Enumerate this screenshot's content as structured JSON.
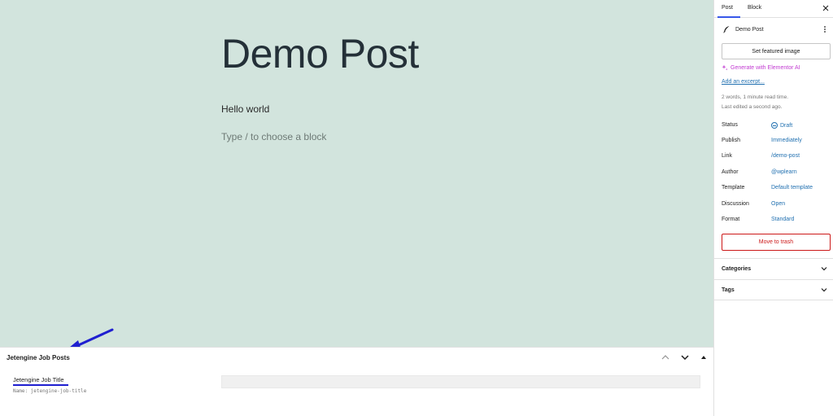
{
  "editor": {
    "post_title": "Demo Post",
    "paragraph": "Hello world",
    "block_placeholder": "Type / to choose a block"
  },
  "metabox": {
    "title": "Jetengine Job Posts",
    "field_label": "Jetengine Job Title",
    "field_name": "Name: jetengine-job-title",
    "field_value": ""
  },
  "sidebar": {
    "tabs": [
      {
        "label": "Post",
        "active": true
      },
      {
        "label": "Block",
        "active": false
      }
    ],
    "post_title": "Demo Post",
    "featured_image_button": "Set featured image",
    "ai_link": "Generate with Elementor AI",
    "excerpt_link": "Add an excerpt...",
    "word_count": "2 words, 1 minute read time.",
    "last_edited": "Last edited a second ago.",
    "meta": [
      {
        "key": "Status",
        "value": "Draft"
      },
      {
        "key": "Publish",
        "value": "Immediately"
      },
      {
        "key": "Link",
        "value": "/demo-post"
      },
      {
        "key": "Author",
        "value": "@wplearn"
      },
      {
        "key": "Template",
        "value": "Default template"
      },
      {
        "key": "Discussion",
        "value": "Open"
      },
      {
        "key": "Format",
        "value": "Standard"
      }
    ],
    "trash_button": "Move to trash",
    "panels": [
      {
        "label": "Categories"
      },
      {
        "label": "Tags"
      }
    ]
  },
  "colors": {
    "canvas_bg": "#d2e4dd",
    "accent": "#3858e9",
    "link": "#2271b1",
    "danger": "#cc1818",
    "ai": "#c13bd1",
    "annotation_arrow": "#1f1fd0"
  },
  "icons": [
    "close-icon",
    "feather-icon",
    "kebab-menu-icon",
    "sparkle-icon",
    "draft-status-icon",
    "chevron-up-icon",
    "chevron-down-icon",
    "triangle-up-icon",
    "annotation-arrow-icon"
  ]
}
